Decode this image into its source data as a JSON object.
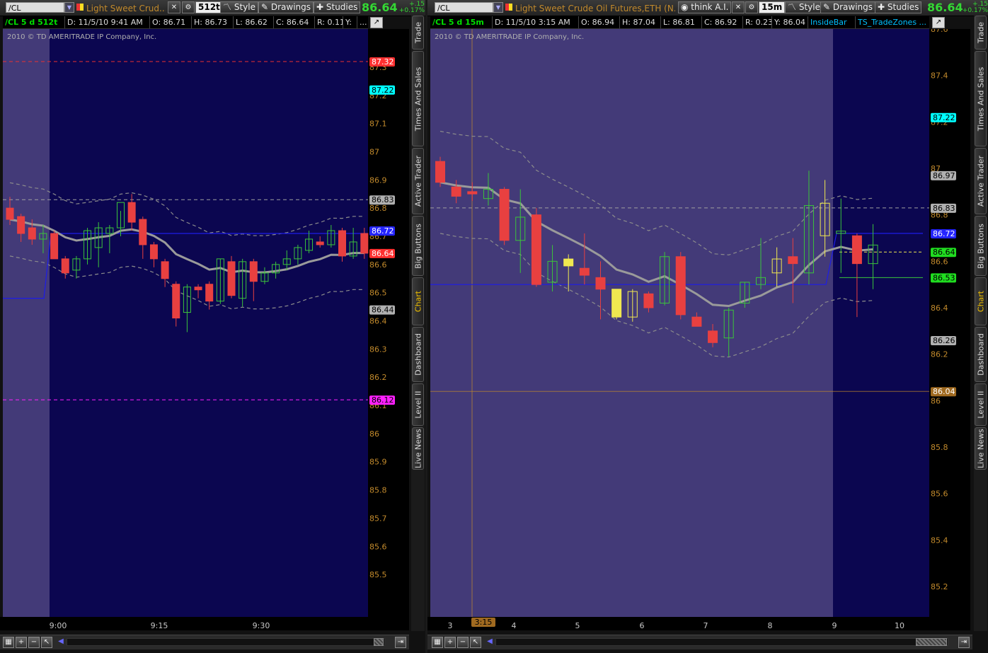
{
  "colors": {
    "bg_dark": "#0b0650",
    "bg_light": "#433a78",
    "up": "#3bc43b",
    "down": "#e84040",
    "inside": "#f0e850",
    "ma": "#9a9a9a",
    "band": "#8c8c8c",
    "zone": "#1c1ce8",
    "price_axis": "#c28a2c",
    "last_label": "#ff3030",
    "label_cyan": "#00ffff",
    "label_grey": "#b0b0b0",
    "label_magenta": "#ff20ff",
    "label_blue": "#2424ff",
    "label_green": "#20dd20",
    "label_orange": "#a06a20"
  },
  "left": {
    "symbol": "/CL",
    "title": "Light Sweet Crud...",
    "aggregation": "512tk",
    "style_label": "Style",
    "drawings_label": "Drawings",
    "studies_label": "Studies",
    "last": "86.64",
    "change": "+.15",
    "change_pct": "+0.17%",
    "info": {
      "sym": "/CL 5 d 512t",
      "date": "D: 11/5/10 9:41 AM",
      "open": "O: 86.71",
      "high": "H: 86.73",
      "low": "L: 86.62",
      "close": "C: 86.64",
      "range": "R: 0.11",
      "y": "Y:",
      "more": "..."
    },
    "copyright": "2010 © TD AMERITRADE IP Company, Inc.",
    "yaxis": {
      "min": 85.43,
      "max": 87.35,
      "ticks": [
        "87.3",
        "87.2",
        "87.1",
        "87",
        "86.9",
        "86.8",
        "86.7",
        "86.6",
        "86.5",
        "86.4",
        "86.3",
        "86.2",
        "86.1",
        "86",
        "85.9",
        "85.8",
        "85.7",
        "85.6",
        "85.5"
      ]
    },
    "xaxis": {
      "labels": [
        "9:00",
        "9:15",
        "9:30"
      ]
    },
    "price_labels": [
      {
        "text": "87.32",
        "value": 87.32,
        "color": "#ff3030"
      },
      {
        "text": "87.22",
        "value": 87.22,
        "color": "#00ffff"
      },
      {
        "text": "86.83",
        "value": 86.83,
        "color": "#b0b0b0"
      },
      {
        "text": "86.72",
        "value": 86.72,
        "color": "#2424ff"
      },
      {
        "text": "86.64",
        "value": 86.64,
        "color": "#ff3030"
      },
      {
        "text": "86.44",
        "value": 86.44,
        "color": "#b0b0b0"
      },
      {
        "text": "86.12",
        "value": 86.12,
        "color": "#ff20ff"
      }
    ],
    "hlines": [
      {
        "value": 87.32,
        "color": "#e83030"
      },
      {
        "value": 86.83,
        "color": "#a0a0a0"
      },
      {
        "value": 86.12,
        "color": "#ff20ff"
      }
    ],
    "candles": [
      {
        "o": 86.8,
        "h": 86.84,
        "l": 86.74,
        "c": 86.76
      },
      {
        "o": 86.77,
        "h": 86.78,
        "l": 86.68,
        "c": 86.71
      },
      {
        "o": 86.73,
        "h": 86.76,
        "l": 86.67,
        "c": 86.69
      },
      {
        "o": 86.69,
        "h": 86.74,
        "l": 86.64,
        "c": 86.71
      },
      {
        "o": 86.71,
        "h": 86.72,
        "l": 86.62,
        "c": 86.62
      },
      {
        "o": 86.62,
        "h": 86.63,
        "l": 86.55,
        "c": 86.57
      },
      {
        "o": 86.58,
        "h": 86.63,
        "l": 86.55,
        "c": 86.62
      },
      {
        "o": 86.62,
        "h": 86.73,
        "l": 86.6,
        "c": 86.72
      },
      {
        "o": 86.66,
        "h": 86.75,
        "l": 86.59,
        "c": 86.73
      },
      {
        "o": 86.71,
        "h": 86.74,
        "l": 86.64,
        "c": 86.73
      },
      {
        "o": 86.73,
        "h": 86.79,
        "l": 86.7,
        "c": 86.82
      },
      {
        "o": 86.82,
        "h": 86.85,
        "l": 86.72,
        "c": 86.75
      },
      {
        "o": 86.76,
        "h": 86.77,
        "l": 86.62,
        "c": 86.67
      },
      {
        "o": 86.67,
        "h": 86.68,
        "l": 86.59,
        "c": 86.62
      },
      {
        "o": 86.61,
        "h": 86.62,
        "l": 86.52,
        "c": 86.55
      },
      {
        "o": 86.53,
        "h": 86.54,
        "l": 86.38,
        "c": 86.41
      },
      {
        "o": 86.43,
        "h": 86.53,
        "l": 86.36,
        "c": 86.52
      },
      {
        "o": 86.52,
        "h": 86.53,
        "l": 86.48,
        "c": 86.51
      },
      {
        "o": 86.53,
        "h": 86.54,
        "l": 86.44,
        "c": 86.47
      },
      {
        "o": 86.47,
        "h": 86.62,
        "l": 86.46,
        "c": 86.62
      },
      {
        "o": 86.61,
        "h": 86.63,
        "l": 86.48,
        "c": 86.49
      },
      {
        "o": 86.48,
        "h": 86.62,
        "l": 86.45,
        "c": 86.61
      },
      {
        "o": 86.61,
        "h": 86.62,
        "l": 86.47,
        "c": 86.54
      },
      {
        "o": 86.54,
        "h": 86.59,
        "l": 86.53,
        "c": 86.57
      },
      {
        "o": 86.57,
        "h": 86.61,
        "l": 86.55,
        "c": 86.6
      },
      {
        "o": 86.6,
        "h": 86.65,
        "l": 86.58,
        "c": 86.62
      },
      {
        "o": 86.62,
        "h": 86.67,
        "l": 86.6,
        "c": 86.66
      },
      {
        "o": 86.65,
        "h": 86.72,
        "l": 86.64,
        "c": 86.69
      },
      {
        "o": 86.68,
        "h": 86.7,
        "l": 86.66,
        "c": 86.67
      },
      {
        "o": 86.67,
        "h": 86.74,
        "l": 86.66,
        "c": 86.72
      },
      {
        "o": 86.72,
        "h": 86.73,
        "l": 86.61,
        "c": 86.63
      },
      {
        "o": 86.63,
        "h": 86.73,
        "l": 86.62,
        "c": 86.68
      },
      {
        "o": 86.71,
        "h": 86.73,
        "l": 86.62,
        "c": 86.64
      }
    ]
  },
  "right": {
    "symbol": "/CL",
    "title": "Light Sweet Crude Oil Futures,ETH (N...",
    "thinkai_label": "think A.I.",
    "aggregation": "15m",
    "style_label": "Style",
    "drawings_label": "Drawings",
    "studies_label": "Studies",
    "last": "86.64",
    "change": "+.15",
    "change_pct": "+0.17%",
    "info": {
      "sym": "/CL 5 d 15m",
      "date": "D: 11/5/10 3:15 AM",
      "open": "O: 86.94",
      "high": "H: 87.04",
      "low": "L: 86.81",
      "close": "C: 86.92",
      "range": "R: 0.23",
      "y": "Y: 86.04",
      "study1": "InsideBar",
      "study2": "TS_TradeZones ..."
    },
    "copyright": "2010 © TD AMERITRADE IP Company, Inc.",
    "yaxis": {
      "min": 85.13,
      "max": 87.6,
      "ticks": [
        "87.6",
        "87.4",
        "87.2",
        "87",
        "86.8",
        "86.6",
        "86.4",
        "86.2",
        "86",
        "85.8",
        "85.6",
        "85.4",
        "85.2"
      ]
    },
    "xaxis": {
      "labels": [
        "3",
        "4",
        "5",
        "6",
        "7",
        "8",
        "9",
        "10"
      ],
      "cursor_label": "3:15"
    },
    "price_labels": [
      {
        "text": "87.22",
        "value": 87.22,
        "color": "#00ffff"
      },
      {
        "text": "86.97",
        "value": 86.97,
        "color": "#b0b0b0"
      },
      {
        "text": "86.83",
        "value": 86.83,
        "color": "#b0b0b0"
      },
      {
        "text": "86.72",
        "value": 86.72,
        "color": "#2424ff"
      },
      {
        "text": "86.64",
        "value": 86.64,
        "color": "#20dd20"
      },
      {
        "text": "86.53",
        "value": 86.53,
        "color": "#20dd20"
      },
      {
        "text": "86.26",
        "value": 86.26,
        "color": "#b0b0b0"
      },
      {
        "text": "86.04",
        "value": 86.04,
        "color": "#a06a20"
      }
    ],
    "candles": [
      {
        "o": 87.03,
        "h": 87.05,
        "l": 86.92,
        "c": 86.94,
        "t": "d"
      },
      {
        "o": 86.92,
        "h": 86.95,
        "l": 86.85,
        "c": 86.88,
        "t": "d"
      },
      {
        "o": 86.9,
        "h": 86.94,
        "l": 86.86,
        "c": 86.89,
        "t": "d"
      },
      {
        "o": 86.87,
        "h": 86.98,
        "l": 86.84,
        "c": 86.91,
        "t": "u"
      },
      {
        "o": 86.91,
        "h": 86.92,
        "l": 86.67,
        "c": 86.69,
        "t": "d"
      },
      {
        "o": 86.69,
        "h": 86.91,
        "l": 86.55,
        "c": 86.79,
        "t": "u"
      },
      {
        "o": 86.8,
        "h": 86.83,
        "l": 86.49,
        "c": 86.5,
        "t": "d"
      },
      {
        "o": 86.51,
        "h": 86.67,
        "l": 86.47,
        "c": 86.6,
        "t": "u"
      },
      {
        "o": 86.61,
        "h": 86.63,
        "l": 86.47,
        "c": 86.58,
        "t": "i"
      },
      {
        "o": 86.57,
        "h": 86.72,
        "l": 86.5,
        "c": 86.54,
        "t": "d"
      },
      {
        "o": 86.53,
        "h": 86.6,
        "l": 86.35,
        "c": 86.48,
        "t": "d"
      },
      {
        "o": 86.48,
        "h": 86.48,
        "l": 86.35,
        "c": 86.36,
        "t": "i"
      },
      {
        "o": 86.36,
        "h": 86.48,
        "l": 86.34,
        "c": 86.47,
        "t": "i"
      },
      {
        "o": 86.46,
        "h": 86.47,
        "l": 86.38,
        "c": 86.4,
        "t": "d"
      },
      {
        "o": 86.42,
        "h": 86.64,
        "l": 86.41,
        "c": 86.62,
        "t": "u"
      },
      {
        "o": 86.62,
        "h": 86.64,
        "l": 86.35,
        "c": 86.37,
        "t": "d"
      },
      {
        "o": 86.36,
        "h": 86.38,
        "l": 86.32,
        "c": 86.32,
        "t": "d"
      },
      {
        "o": 86.3,
        "h": 86.33,
        "l": 86.23,
        "c": 86.25,
        "t": "d"
      },
      {
        "o": 86.27,
        "h": 86.4,
        "l": 86.19,
        "c": 86.39,
        "t": "u"
      },
      {
        "o": 86.42,
        "h": 86.51,
        "l": 86.4,
        "c": 86.51,
        "t": "u"
      },
      {
        "o": 86.5,
        "h": 86.7,
        "l": 86.48,
        "c": 86.53,
        "t": "u"
      },
      {
        "o": 86.55,
        "h": 86.66,
        "l": 86.49,
        "c": 86.61,
        "t": "i"
      },
      {
        "o": 86.62,
        "h": 86.7,
        "l": 86.42,
        "c": 86.59,
        "t": "d"
      },
      {
        "o": 86.55,
        "h": 86.99,
        "l": 86.5,
        "c": 86.84,
        "t": "u"
      },
      {
        "o": 86.71,
        "h": 86.95,
        "l": 86.62,
        "c": 86.85,
        "t": "i"
      },
      {
        "o": 86.72,
        "h": 86.87,
        "l": 86.55,
        "c": 86.73,
        "t": "u"
      },
      {
        "o": 86.71,
        "h": 86.72,
        "l": 86.36,
        "c": 86.59,
        "t": "d"
      },
      {
        "o": 86.59,
        "h": 86.76,
        "l": 86.48,
        "c": 86.67,
        "t": "u"
      }
    ]
  },
  "side_tabs": [
    "Trade",
    "Times And Sales",
    "Active Trader",
    "Big Buttons",
    "Chart",
    "Dashboard",
    "Level II",
    "Live News"
  ],
  "active_tab": "Chart"
}
